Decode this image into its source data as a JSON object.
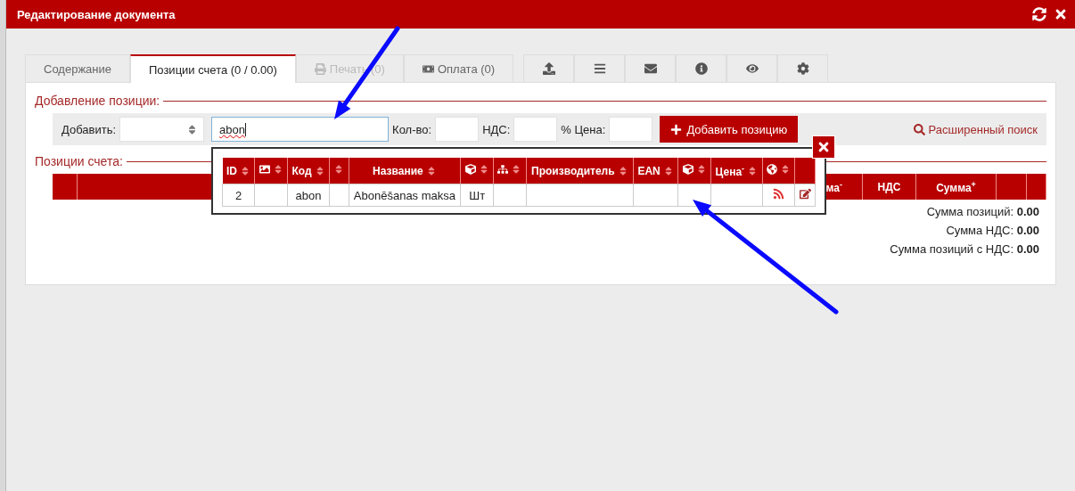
{
  "window": {
    "title": "Редактирование документа"
  },
  "tabs": [
    {
      "label": "Содержание",
      "selected": false,
      "disabled": false
    },
    {
      "label": "Позиции счета (0 / 0.00)",
      "selected": true,
      "disabled": false
    },
    {
      "label": "Печать (0)",
      "selected": false,
      "disabled": true
    },
    {
      "label": "Оплата (0)",
      "selected": false,
      "disabled": false
    }
  ],
  "icon_tabs": [
    {
      "kind": "upload",
      "selected": false
    },
    {
      "kind": "list",
      "selected": false
    },
    {
      "kind": "mail",
      "selected": false
    },
    {
      "kind": "info",
      "selected": false
    },
    {
      "kind": "view",
      "selected": false
    },
    {
      "kind": "settings",
      "selected": false
    }
  ],
  "add_section": {
    "legend": "Добавление позиции:",
    "add_label": "Добавить:",
    "search_value": "abon",
    "qty_label": "Кол-во:",
    "vat_label": "НДС:",
    "price_label": "% Цена:",
    "add_button": "Добавить позицию",
    "advanced_search": "Расширенный поиск"
  },
  "positions": {
    "legend": "Позиции счета:",
    "columns": [
      {
        "label": "ма$^{-}$"
      },
      {
        "label": "НДС"
      },
      {
        "label": "Сумма$^{+}$"
      }
    ],
    "totals": [
      {
        "label": "Сумма позиций:",
        "value": "0.00"
      },
      {
        "label": "Сумма НДС:",
        "value": "0.00"
      },
      {
        "label": "Сумма позиций с НДС:",
        "value": "0.00"
      }
    ]
  },
  "popup": {
    "columns": [
      {
        "kind": "text",
        "label": "ID",
        "sortable": true
      },
      {
        "kind": "image",
        "sortable": true
      },
      {
        "kind": "text",
        "label": "Код",
        "sortable": true
      },
      {
        "kind": "blank",
        "sortable": true
      },
      {
        "kind": "text",
        "label": "Название",
        "sortable": true
      },
      {
        "kind": "box",
        "sortable": true
      },
      {
        "kind": "sitemap",
        "sortable": true
      },
      {
        "kind": "text",
        "label": "Производитель",
        "sortable": true
      },
      {
        "kind": "text",
        "label": "EAN",
        "sortable": true
      },
      {
        "kind": "box",
        "sortable": true
      },
      {
        "kind": "text",
        "label": "Цена$^{-}$",
        "sortable": true
      },
      {
        "kind": "globe",
        "sortable": true
      },
      {
        "kind": "blank",
        "sortable": false
      }
    ],
    "rows": [
      {
        "cells": [
          {
            "kind": "text",
            "text": "2"
          },
          {
            "kind": "empty"
          },
          {
            "kind": "text",
            "text": "abon"
          },
          {
            "kind": "empty"
          },
          {
            "kind": "text",
            "text": "Abonēšanas maksa"
          },
          {
            "kind": "text",
            "text": "Шт"
          },
          {
            "kind": "empty"
          },
          {
            "kind": "empty"
          },
          {
            "kind": "empty"
          },
          {
            "kind": "empty"
          },
          {
            "kind": "empty"
          },
          {
            "kind": "rss"
          },
          {
            "kind": "edit"
          }
        ]
      }
    ]
  }
}
